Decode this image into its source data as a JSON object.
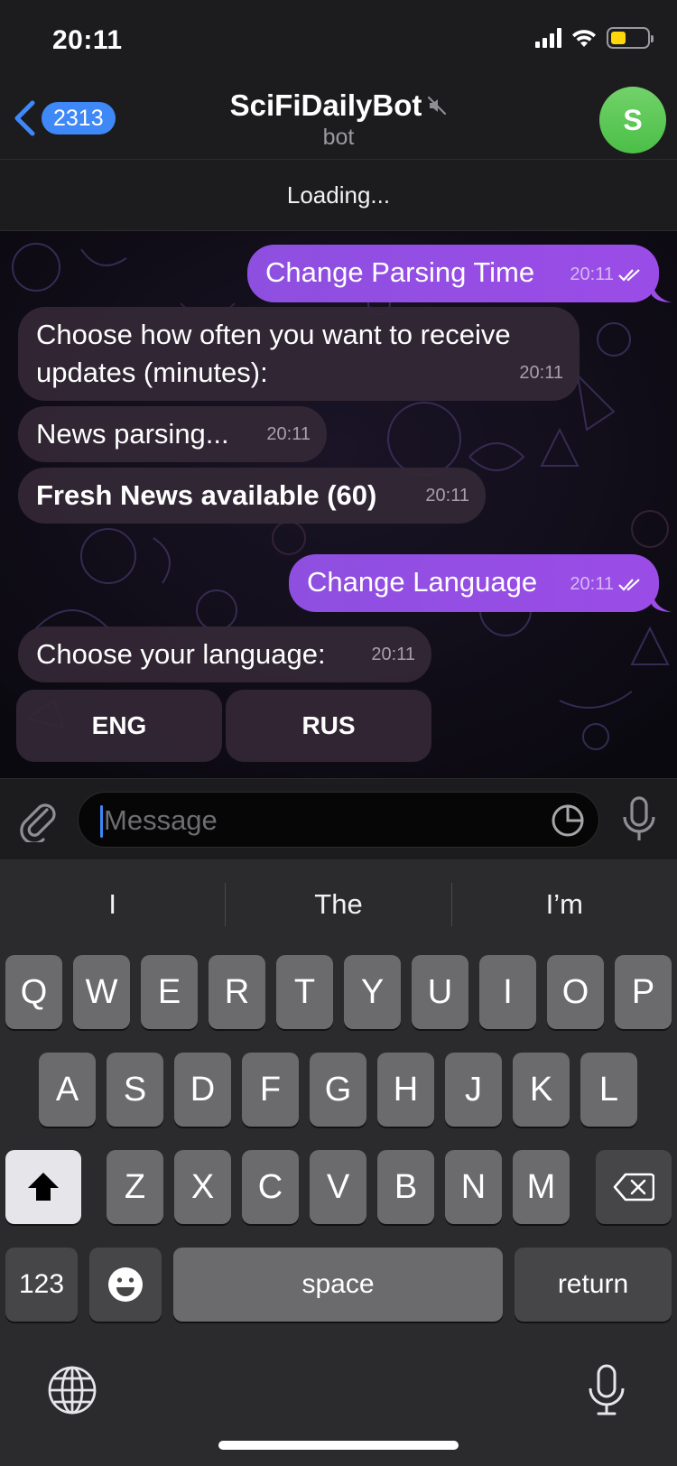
{
  "status_bar": {
    "time": "20:11"
  },
  "header": {
    "back_badge": "2313",
    "title": "SciFiDailyBot",
    "subtitle": "bot",
    "avatar_initial": "S"
  },
  "pinned": {
    "text": "Loading..."
  },
  "messages": [
    {
      "direction": "out",
      "text": "Change Parsing Time",
      "time": "20:11"
    },
    {
      "direction": "in",
      "text_line1": "Choose how often you want to receive",
      "text_line2": "updates (minutes):",
      "time": "20:11"
    },
    {
      "direction": "in",
      "text": "News parsing...",
      "time": "20:11"
    },
    {
      "direction": "in",
      "text": "Fresh News available (60)",
      "time": "20:11",
      "bold": true
    },
    {
      "direction": "out",
      "text": "Change Language",
      "time": "20:11"
    },
    {
      "direction": "in",
      "text": "Choose your language:",
      "time": "20:11"
    }
  ],
  "inline_keyboard": [
    {
      "label": "ENG"
    },
    {
      "label": "RUS"
    }
  ],
  "composer": {
    "placeholder": "Message"
  },
  "keyboard": {
    "suggestions": [
      "I",
      "The",
      "I’m"
    ],
    "row1": [
      "Q",
      "W",
      "E",
      "R",
      "T",
      "Y",
      "U",
      "I",
      "O",
      "P"
    ],
    "row2": [
      "A",
      "S",
      "D",
      "F",
      "G",
      "H",
      "J",
      "K",
      "L"
    ],
    "row3": [
      "Z",
      "X",
      "C",
      "V",
      "B",
      "N",
      "M"
    ],
    "numbers_label": "123",
    "space_label": "space",
    "return_label": "return"
  },
  "colors": {
    "accent": "#3e88f7",
    "outgoing_bubble": "#9b4ce7",
    "incoming_bubble": "#342836",
    "avatar": "#4bbf47"
  }
}
